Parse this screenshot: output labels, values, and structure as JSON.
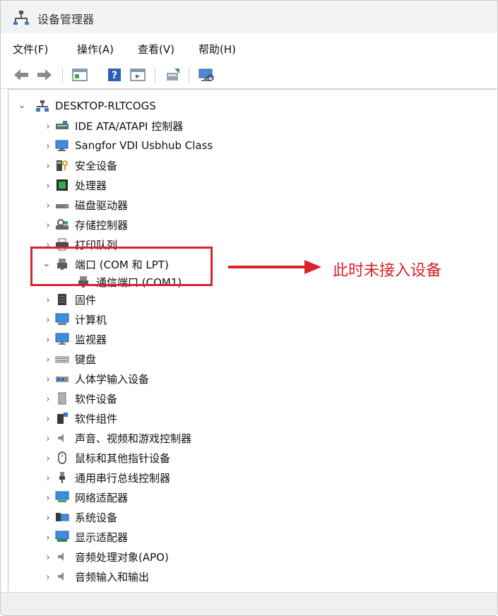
{
  "window": {
    "title": "设备管理器"
  },
  "menu": [
    "文件(F)",
    "操作(A)",
    "查看(V)",
    "帮助(H)"
  ],
  "tree": {
    "root": "DESKTOP-RLTCOGS",
    "items": [
      {
        "label": "IDE ATA/ATAPI 控制器",
        "expanded": false
      },
      {
        "label": "Sangfor VDI Usbhub Class",
        "expanded": false
      },
      {
        "label": "安全设备",
        "expanded": false
      },
      {
        "label": "处理器",
        "expanded": false
      },
      {
        "label": "磁盘驱动器",
        "expanded": false
      },
      {
        "label": "存储控制器",
        "expanded": false
      },
      {
        "label": "打印队列",
        "expanded": false
      },
      {
        "label": "端口 (COM 和 LPT)",
        "expanded": true,
        "children": [
          "通信端口 (COM1)"
        ]
      },
      {
        "label": "固件",
        "expanded": false
      },
      {
        "label": "计算机",
        "expanded": false
      },
      {
        "label": "监视器",
        "expanded": false
      },
      {
        "label": "键盘",
        "expanded": false
      },
      {
        "label": "人体学输入设备",
        "expanded": false
      },
      {
        "label": "软件设备",
        "expanded": false
      },
      {
        "label": "软件组件",
        "expanded": false
      },
      {
        "label": "声音、视频和游戏控制器",
        "expanded": false
      },
      {
        "label": "鼠标和其他指针设备",
        "expanded": false
      },
      {
        "label": "通用串行总线控制器",
        "expanded": false
      },
      {
        "label": "网络适配器",
        "expanded": false
      },
      {
        "label": "系统设备",
        "expanded": false
      },
      {
        "label": "显示适配器",
        "expanded": false
      },
      {
        "label": "音频处理对象(APO)",
        "expanded": false
      },
      {
        "label": "音频输入和输出",
        "expanded": false
      }
    ]
  },
  "annotation": {
    "text": "此时未接入设备",
    "color": "#d8232a"
  },
  "icons": {
    "title": "device-manager-icon",
    "toolbar": [
      "back-icon",
      "forward-icon",
      "show-hide-tree-icon",
      "help-icon",
      "properties-icon",
      "update-driver-icon",
      "scan-hardware-icon"
    ]
  }
}
